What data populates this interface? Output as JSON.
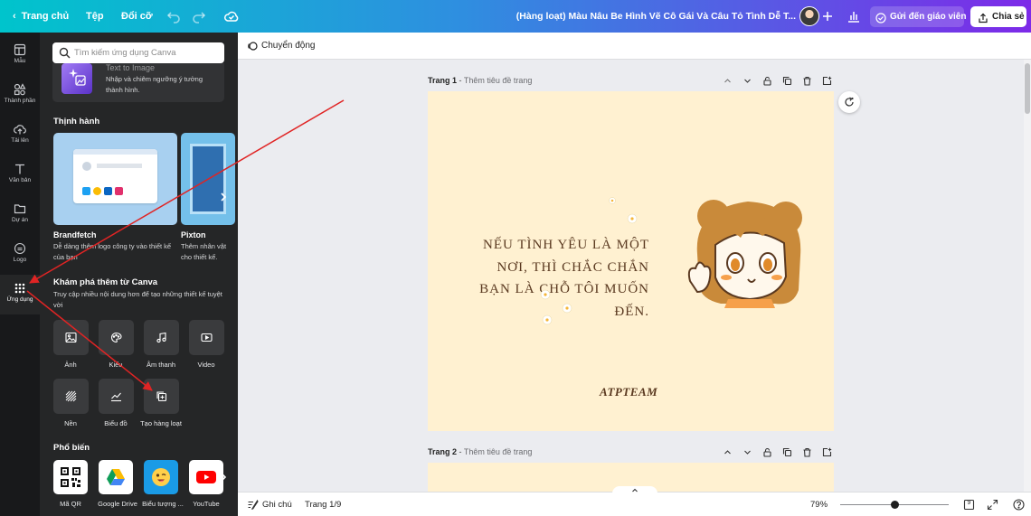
{
  "topbar": {
    "back_label": "Trang chủ",
    "file_label": "Tệp",
    "resize_label": "Đổi cỡ",
    "undo_icon": "undo-icon",
    "redo_icon": "redo-icon",
    "saved_icon": "cloud-saved-icon",
    "document_title": "(Hàng loạt) Màu Nâu Be Hình Vẽ Cô Gái Và Câu Tỏ Tình Dễ T...",
    "add_icon": "plus-icon",
    "insights_icon": "bar-chart-icon",
    "send_teacher_label": "Gửi đến giáo viên",
    "share_label": "Chia sẻ"
  },
  "rail": {
    "items": [
      {
        "label": "Mẫu",
        "icon": "templates-icon"
      },
      {
        "label": "Thành phần",
        "icon": "elements-icon"
      },
      {
        "label": "Tải lên",
        "icon": "upload-icon"
      },
      {
        "label": "Văn bản",
        "icon": "text-icon"
      },
      {
        "label": "Dự án",
        "icon": "folder-icon"
      },
      {
        "label": "Logo",
        "icon": "logo-icon"
      },
      {
        "label": "Ứng dụng",
        "icon": "apps-icon",
        "active": true
      }
    ]
  },
  "panel": {
    "search_placeholder": "Tìm kiếm ứng dụng Canva",
    "prev_card": {
      "title": "Text to Image",
      "desc": "Nhập và chiêm ngưỡng ý tưởng thành hình."
    },
    "trending_heading": "Thịnh hành",
    "trending": [
      {
        "name": "Brandfetch",
        "desc_line1": "Dễ dàng thêm logo công ty vào thiết kế",
        "desc_line2": "của bạn"
      },
      {
        "name": "Pixton",
        "desc_line1": "Thêm nhân vật",
        "desc_line2": "cho thiết kế."
      }
    ],
    "discover_heading": "Khám phá thêm từ Canva",
    "discover_desc": "Truy cập nhiều nội dung hơn để tạo những thiết kế tuyệt vời",
    "discover_items": [
      {
        "label": "Ảnh",
        "icon": "image-icon"
      },
      {
        "label": "Kiểu",
        "icon": "palette-icon"
      },
      {
        "label": "Âm thanh",
        "icon": "music-note-icon"
      },
      {
        "label": "Video",
        "icon": "video-icon"
      },
      {
        "label": "Nền",
        "icon": "pattern-icon"
      },
      {
        "label": "Biểu đồ",
        "icon": "line-chart-icon"
      },
      {
        "label": "Tạo hàng loạt",
        "icon": "bulk-create-icon"
      }
    ],
    "popular_heading": "Phổ biến",
    "popular": [
      {
        "label": "Mã QR",
        "icon": "qr-code-icon"
      },
      {
        "label": "Google Drive",
        "icon": "google-drive-icon"
      },
      {
        "label": "Biểu tượng ...",
        "icon": "emoji-icon"
      },
      {
        "label": "YouTube",
        "icon": "youtube-icon"
      }
    ]
  },
  "canvas": {
    "animate_label": "Chuyển động",
    "pages": [
      {
        "label": "Trang 1",
        "sep": " - ",
        "subtitle": "Thêm tiêu đề trang"
      },
      {
        "label": "Trang 2",
        "sep": " - ",
        "subtitle": "Thêm tiêu đề trang"
      }
    ],
    "poem_lines": [
      "NẾU TÌNH YÊU LÀ MỘT",
      "NƠI, THÌ CHẮC CHẮN",
      "BẠN LÀ CHỖ TÔI MUỐN",
      "ĐẾN."
    ],
    "signature": "ATPTEAM",
    "page_tools": [
      "chevron-up-icon",
      "chevron-down-icon",
      "lock-icon",
      "duplicate-icon",
      "trash-icon",
      "add-page-icon"
    ],
    "colors": {
      "page_bg": "#fff1d1",
      "text": "#5a3920",
      "accent": "#7d2ae8",
      "annotation": "#e02424"
    }
  },
  "bottombar": {
    "notes_label": "Ghi chú",
    "page_counter": "Trang 1/9",
    "zoom": "79%",
    "zoom_fraction": 0.5,
    "grid_badge": "9"
  }
}
